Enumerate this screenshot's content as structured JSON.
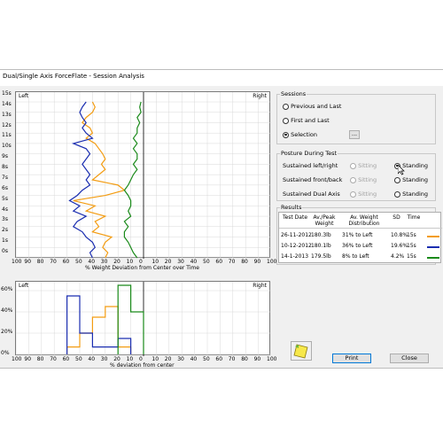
{
  "window": {
    "title": "Dual/Single Axis ForceFlate - Session Analysis"
  },
  "top_chart": {
    "left_label": "Left",
    "right_label": "Right",
    "y_ticks": [
      "15s",
      "14s",
      "13s",
      "12s",
      "11s",
      "10s",
      "9s",
      "8s",
      "7s",
      "6s",
      "5s",
      "4s",
      "3s",
      "2s",
      "1s",
      "0s"
    ],
    "x_ticks": [
      "100",
      "90",
      "80",
      "70",
      "60",
      "50",
      "40",
      "30",
      "20",
      "10",
      "0",
      "10",
      "20",
      "30",
      "40",
      "50",
      "60",
      "70",
      "80",
      "90",
      "100"
    ],
    "xlabel": "% Weight Deviation from Center over Time"
  },
  "bottom_chart": {
    "left_label": "Left",
    "right_label": "Right",
    "y_ticks": [
      "60%",
      "40%",
      "20%",
      "0%"
    ],
    "x_ticks": [
      "100",
      "90",
      "80",
      "70",
      "60",
      "50",
      "40",
      "30",
      "20",
      "10",
      "0",
      "10",
      "20",
      "30",
      "40",
      "50",
      "60",
      "70",
      "80",
      "90",
      "100"
    ],
    "xlabel": "% deviation from center"
  },
  "sessions": {
    "label": "Sessions",
    "options": [
      "Previous and Last",
      "First and Last",
      "Selection"
    ],
    "selected": "Selection",
    "browse_label": "..."
  },
  "posture": {
    "label": "Posture During Test",
    "rows": [
      {
        "label": "Sustained left/right",
        "sitting": "Sitting",
        "standing": "Standing",
        "selected": "standing",
        "sitting_enabled": false
      },
      {
        "label": "Sustained front/back",
        "sitting": "Sitting",
        "standing": "Standing",
        "selected": "none",
        "sitting_enabled": false
      },
      {
        "label": "Sustained Dual Axis",
        "sitting": "Sitting",
        "standing": "Standing",
        "selected": "none",
        "sitting_enabled": false
      }
    ]
  },
  "results": {
    "label": "Results",
    "headers": [
      "Test Date",
      "Av./Peak Weight",
      "Av. Weight Distribution",
      "SD",
      "Time"
    ],
    "rows": [
      {
        "date": "26-11-2012",
        "weight": "180.3lb",
        "dist": "31% to Left",
        "sd": "10.8%",
        "time": "15s",
        "color": "#f39c12"
      },
      {
        "date": "10-12-2012",
        "weight": "180.1lb",
        "dist": "36% to Left",
        "sd": "19.6%",
        "time": "15s",
        "color": "#1a2db0"
      },
      {
        "date": "14-1-2013",
        "weight": "179.5lb",
        "dist": "8% to Left",
        "sd": "4.2%",
        "time": "15s",
        "color": "#1a8a1a"
      }
    ]
  },
  "buttons": {
    "print": "Print",
    "close": "Close"
  },
  "icons": {
    "notes": "sticky-note-icon"
  },
  "chart_data": [
    {
      "type": "line",
      "title": "",
      "xlabel": "% Weight Deviation from Center over Time",
      "ylabel": "",
      "xlim": [
        -100,
        100
      ],
      "ylim": [
        0,
        15
      ],
      "x_note": "negative = Left",
      "series": [
        {
          "color": "#f39c12",
          "x": [
            -30,
            -28,
            -32,
            -30,
            -25,
            -40,
            -35,
            -38,
            -30,
            -45,
            -38,
            -55,
            -30,
            -15,
            -20,
            -40,
            -35,
            -30,
            -33,
            -30,
            -32,
            -35,
            -38,
            -45,
            -40,
            -42,
            -48,
            -45,
            -40,
            -38,
            -40
          ],
          "y": [
            0,
            0.5,
            1,
            1.5,
            2,
            2.5,
            3,
            3.5,
            4,
            4.5,
            5,
            5.5,
            6,
            6.5,
            7,
            7.5,
            8,
            8.5,
            9,
            9.5,
            10,
            10.5,
            11,
            11.5,
            12,
            12.5,
            13,
            13.5,
            14,
            14.5,
            15
          ]
        },
        {
          "color": "#1a2db0",
          "x": [
            -40,
            -42,
            -38,
            -40,
            -45,
            -48,
            -55,
            -52,
            -45,
            -55,
            -50,
            -58,
            -52,
            -48,
            -42,
            -45,
            -42,
            -45,
            -48,
            -45,
            -42,
            -45,
            -55,
            -40,
            -45,
            -48,
            -45,
            -48,
            -50,
            -48,
            -45
          ],
          "y": [
            0,
            0.5,
            1,
            1.5,
            2,
            2.5,
            3,
            3.5,
            4,
            4.5,
            5,
            5.5,
            6,
            6.5,
            7,
            7.5,
            8,
            8.5,
            9,
            9.5,
            10,
            10.5,
            11,
            11.5,
            12,
            12.5,
            13,
            13.5,
            14,
            14.5,
            15
          ]
        },
        {
          "color": "#1a8a1a",
          "x": [
            -5,
            -8,
            -10,
            -12,
            -15,
            -15,
            -12,
            -15,
            -10,
            -12,
            -10,
            -10,
            -12,
            -15,
            -12,
            -10,
            -8,
            -5,
            -8,
            -5,
            -5,
            -8,
            -5,
            -8,
            -5,
            -5,
            -3,
            -5,
            -2,
            -3,
            -2
          ],
          "y": [
            0,
            0.5,
            1,
            1.5,
            2,
            2.5,
            3,
            3.5,
            4,
            4.5,
            5,
            5.5,
            6,
            6.5,
            7,
            7.5,
            8,
            8.5,
            9,
            9.5,
            10,
            10.5,
            11,
            11.5,
            12,
            12.5,
            13,
            13.5,
            14,
            14.5,
            15
          ]
        }
      ]
    },
    {
      "type": "bar",
      "title": "",
      "xlabel": "% deviation from center",
      "ylabel": "",
      "xlim": [
        -100,
        100
      ],
      "ylim": [
        0,
        60
      ],
      "series": [
        {
          "color": "#f39c12",
          "bins": [
            [
              -60,
              -50,
              7
            ],
            [
              -50,
              -40,
              20
            ],
            [
              -40,
              -30,
              35
            ],
            [
              -30,
              -20,
              45
            ],
            [
              -20,
              -10,
              7
            ]
          ]
        },
        {
          "color": "#1a2db0",
          "bins": [
            [
              -60,
              -50,
              55
            ],
            [
              -50,
              -40,
              20
            ],
            [
              -40,
              -30,
              7
            ],
            [
              -30,
              -20,
              7
            ],
            [
              -20,
              -10,
              15
            ]
          ]
        },
        {
          "color": "#1a8a1a",
          "bins": [
            [
              -20,
              -10,
              65
            ],
            [
              -10,
              0,
              40
            ]
          ]
        }
      ]
    }
  ]
}
